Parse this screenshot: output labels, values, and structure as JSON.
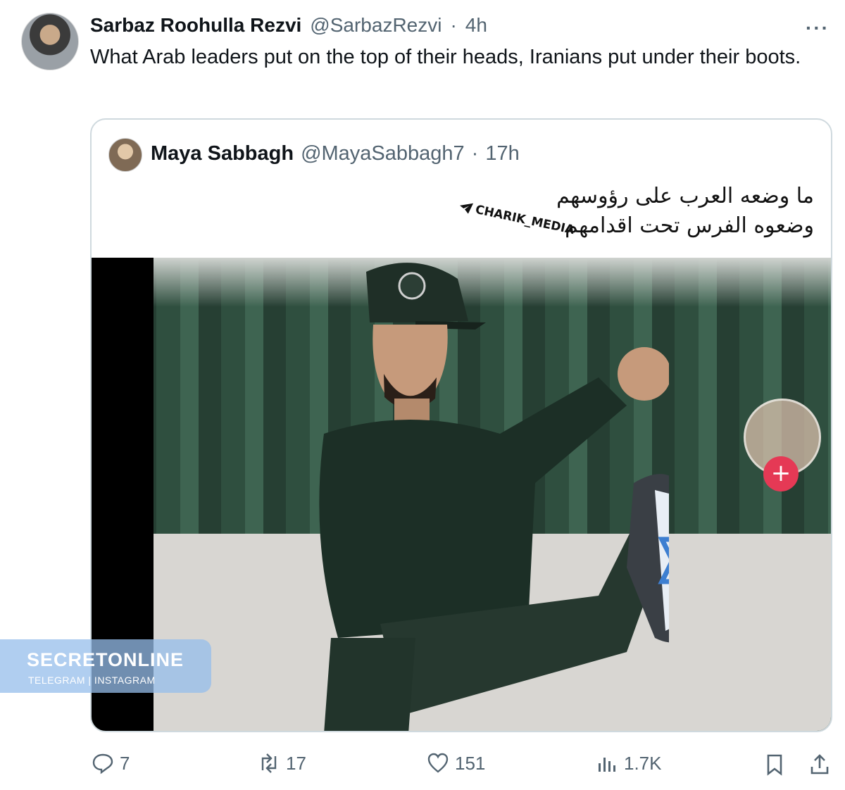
{
  "tweet": {
    "display_name": "Sarbaz Roohulla Rezvi",
    "handle": "@SarbazRezvi",
    "separator": "·",
    "time": "4h",
    "more": "···",
    "text": "What Arab leaders put on the top of their heads, Iranians put under their boots."
  },
  "quote": {
    "display_name": "Maya Sabbagh",
    "handle": "@MayaSabbagh7",
    "separator": "·",
    "time": "17h",
    "arabic_line1": "ما وضعه العرب على رؤوسهم",
    "arabic_line2": "وضعوه الفرس تحت اقدامهم",
    "watermark": "CHARIK_MEDIA",
    "image_overlay": {
      "tiktok_plus": "+"
    }
  },
  "overlay_watermark": {
    "title": "SECRETONLINE",
    "subtitle": "TELEGRAM | INSTAGRAM"
  },
  "actions": {
    "replies": "7",
    "reposts": "17",
    "likes": "151",
    "views": "1.7K"
  },
  "colors": {
    "secondary_text": "#536471",
    "border": "#cfd9de",
    "tiktok_plus": "#e53955"
  },
  "icons": {
    "reply": "reply-icon",
    "repost": "repost-icon",
    "like": "heart-icon",
    "views": "views-icon",
    "bookmark": "bookmark-icon",
    "share": "share-icon",
    "more": "more-icon"
  }
}
